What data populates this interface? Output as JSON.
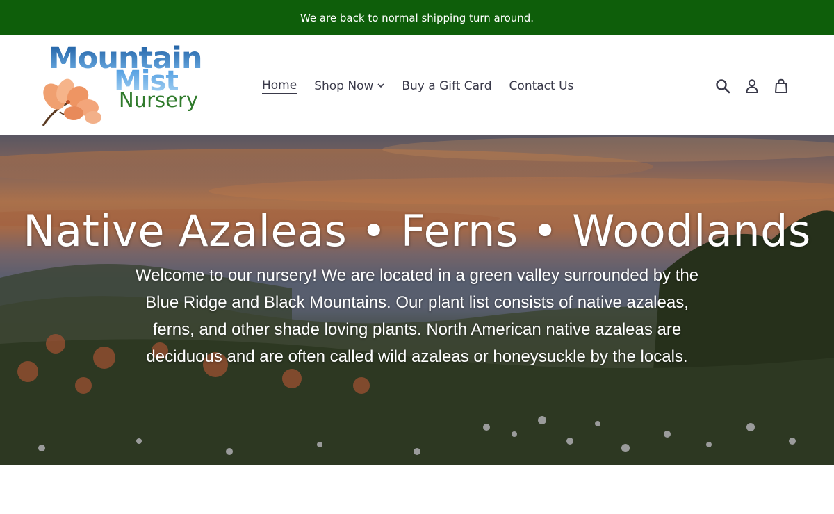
{
  "announcement": {
    "text": "We are back to normal shipping turn around."
  },
  "logo": {
    "line1": "Mountain",
    "line2": "Mist",
    "line3": "Nursery"
  },
  "nav": {
    "items": [
      {
        "label": "Home",
        "active": true
      },
      {
        "label": "Shop Now",
        "dropdown": true
      },
      {
        "label": "Buy a Gift Card"
      },
      {
        "label": "Contact Us"
      }
    ],
    "dropdown_icon": "chevron-down-icon"
  },
  "header_icons": [
    "search-icon",
    "account-icon",
    "cart-icon"
  ],
  "hero": {
    "title": "Native Azaleas • Ferns • Woodlands",
    "text": "Welcome to our nursery!  We are located in a green valley surrounded by the Blue Ridge and Black Mountains.  Our plant list consists of native azaleas, ferns, and other shade loving plants. North American native azaleas are deciduous and are often called wild azaleas or honeysuckle by the locals."
  },
  "colors": {
    "announcement_bg": "#0e5e0a",
    "nav_text": "#3a3a4a",
    "logo_blue": "#2d6fb0",
    "logo_green": "#2f7a2b"
  }
}
